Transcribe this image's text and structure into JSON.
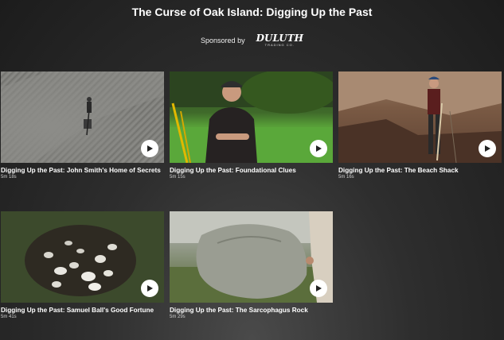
{
  "page": {
    "title": "The Curse of Oak Island: Digging Up the Past"
  },
  "sponsor": {
    "label": "Sponsored by",
    "logo_text": "DULUTH",
    "logo_sub": "TRADING CO."
  },
  "videos": [
    {
      "title": "Digging Up the Past: John Smith's Home of Secrets",
      "duration": "5m 18s"
    },
    {
      "title": "Digging Up the Past: Foundational Clues",
      "duration": "5m 15s"
    },
    {
      "title": "Digging Up the Past: The Beach Shack",
      "duration": "5m 16s"
    },
    {
      "title": "Digging Up the Past: Samuel Ball's Good Fortune",
      "duration": "5m 41s"
    },
    {
      "title": "Digging Up the Past: The Sarcophagus Rock",
      "duration": "5m 29s"
    }
  ],
  "icons": {
    "play": "play-icon"
  }
}
